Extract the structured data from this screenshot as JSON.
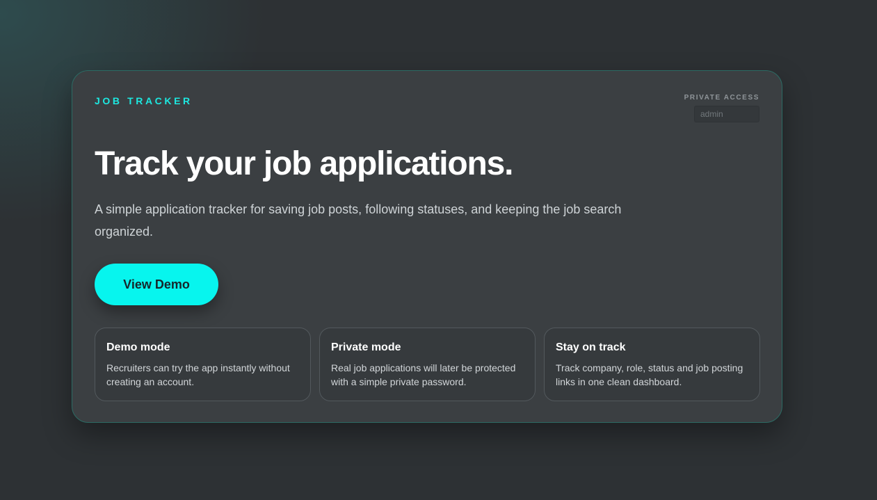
{
  "header": {
    "brand": "JOB TRACKER",
    "access_label": "PRIVATE ACCESS",
    "access_placeholder": "admin"
  },
  "hero": {
    "title": "Track your job applications.",
    "description": "A simple application tracker for saving job posts, following statuses, and keeping the job search organized.",
    "cta_label": "View Demo"
  },
  "features": [
    {
      "title": "Demo mode",
      "description": "Recruiters can try the app instantly without creating an account."
    },
    {
      "title": "Private mode",
      "description": "Real job applications will later be protected with a simple private password."
    },
    {
      "title": "Stay on track",
      "description": "Track company, role, status and job posting links in one clean dashboard."
    }
  ],
  "colors": {
    "accent": "#07f5ee",
    "brand_text": "#1de8e0",
    "card_background": "#3b3f42",
    "page_background": "#2d3134"
  }
}
